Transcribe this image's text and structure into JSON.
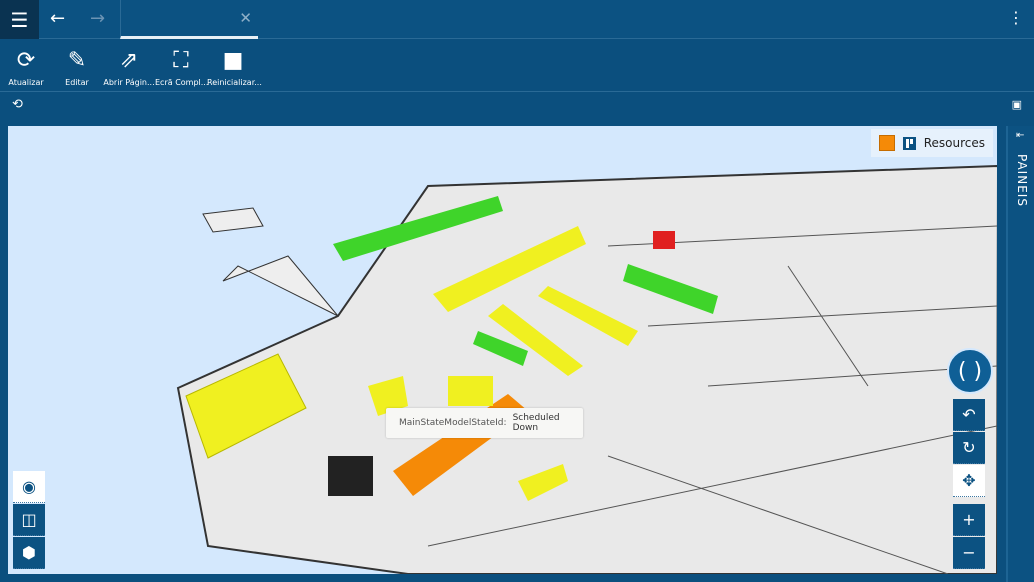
{
  "header": {
    "menu_icon": "hamburger-icon",
    "back_icon": "arrow-left-icon",
    "forward_icon": "arrow-right-icon",
    "tab_title": "",
    "close_icon": "close-icon",
    "more_icon": "kebab-icon"
  },
  "toolbar": {
    "items": [
      {
        "label": "Atualizar",
        "icon": "refresh-icon"
      },
      {
        "label": "Editar",
        "icon": "pencil-icon"
      },
      {
        "label": "Abrir Págin...",
        "icon": "external-link-icon"
      },
      {
        "label": "Ecrã Compl...",
        "icon": "fullscreen-icon"
      },
      {
        "label": "Reinicializar...",
        "icon": "reset-camera-icon"
      }
    ]
  },
  "legend": {
    "label": "Resources",
    "color": "#f58a07"
  },
  "side_panel": {
    "label": "PAINEIS"
  },
  "tooltip": {
    "key": "MainStateModelStateId:",
    "value": "Scheduled Down"
  },
  "colors": {
    "primary": "#0c5282",
    "running": "#3fd42a",
    "idle": "#f0f020",
    "scheduled_down": "#f58a07",
    "down": "#e02020"
  }
}
